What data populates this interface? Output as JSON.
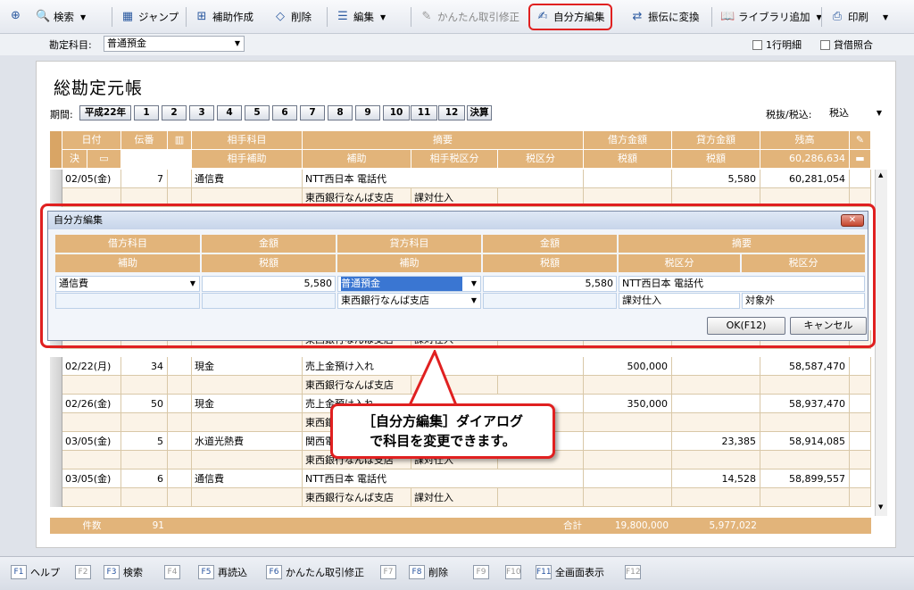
{
  "toolbar": {
    "search": "検索",
    "jump": "ジャンプ",
    "sub_create": "補助作成",
    "delete": "削除",
    "edit": "編集",
    "kantan": "かんたん取引修正",
    "jibun": "自分方編集",
    "furikae": "振伝に変換",
    "library": "ライブラリ追加",
    "print": "印刷"
  },
  "subbar": {
    "account_label": "勘定科目:",
    "account_value": "普通預金",
    "opt1": "1行明細",
    "opt2": "貸借照合"
  },
  "title": "総勘定元帳",
  "period": {
    "label": "期間:",
    "era": "平成22年",
    "months": [
      "1",
      "2",
      "3",
      "4",
      "5",
      "6",
      "7",
      "8",
      "9",
      "10",
      "11",
      "12"
    ],
    "settle": "決算"
  },
  "tax": {
    "label": "税抜/税込:",
    "value": "税込"
  },
  "grid_header": {
    "date": "日付",
    "denpyo": "伝番",
    "aite": "相手科目",
    "tekiyo": "摘要",
    "debit": "借方金額",
    "credit": "貸方金額",
    "balance": "残高",
    "ketsu": "決",
    "aite_sub": "相手補助",
    "sub": "補助",
    "aite_tax": "相手税区分",
    "taxcls": "税区分",
    "tax1": "税額",
    "tax2": "税額",
    "bal2": "60,286,634"
  },
  "rows": [
    {
      "date": "02/05(金)",
      "no": "7",
      "acct": "通信費",
      "desc": "NTT西日本 電話代",
      "debit": "",
      "credit": "5,580",
      "bal": "60,281,054",
      "bank": "東西銀行なんば支店",
      "tax": "課対仕入"
    },
    {
      "date": "",
      "no": "",
      "acct": "",
      "desc": "",
      "debit": "",
      "credit": "",
      "bal": "",
      "bank": "東西銀行なんば支店",
      "tax": "課対仕入"
    },
    {
      "date": "02/22(月)",
      "no": "34",
      "acct": "現金",
      "desc": "売上金預け入れ",
      "debit": "500,000",
      "credit": "",
      "bal": "58,587,470",
      "bank": "東西銀行なんば支店",
      "tax": ""
    },
    {
      "date": "02/26(金)",
      "no": "50",
      "acct": "現金",
      "desc": "売上金預け入れ",
      "debit": "350,000",
      "credit": "",
      "bal": "58,937,470",
      "bank": "東西銀行なんば支店",
      "tax": ""
    },
    {
      "date": "03/05(金)",
      "no": "5",
      "acct": "水道光熱費",
      "desc": "関西電力",
      "debit": "",
      "credit": "23,385",
      "bal": "58,914,085",
      "bank": "東西銀行なんば支店",
      "tax": "課対仕入"
    },
    {
      "date": "03/05(金)",
      "no": "6",
      "acct": "通信費",
      "desc": "NTT西日本 電話代",
      "debit": "",
      "credit": "14,528",
      "bal": "58,899,557",
      "bank": "東西銀行なんば支店",
      "tax": "課対仕入"
    }
  ],
  "footer": {
    "count_label": "件数",
    "count": "91",
    "total_label": "合計",
    "debit_total": "19,800,000",
    "credit_total": "5,977,022"
  },
  "dialog": {
    "title": "自分方編集",
    "h_debit": "借方科目",
    "h_amount": "金額",
    "h_credit": "貸方科目",
    "h_amount2": "金額",
    "h_tekiyo": "摘要",
    "h_sub": "補助",
    "h_tax": "税額",
    "h_sub2": "補助",
    "h_tax2": "税額",
    "h_taxcls": "税区分",
    "h_taxcls2": "税区分",
    "debit_acct": "通信費",
    "amount": "5,580",
    "credit_acct": "普通預金",
    "amount2": "5,580",
    "tekiyo": "NTT西日本 電話代",
    "bank": "東西銀行なんば支店",
    "taxcls1": "課対仕入",
    "taxcls2": "対象外",
    "ok": "OK(F12)",
    "cancel": "キャンセル"
  },
  "callout": {
    "line1": "［自分方編集］ダイアログ",
    "line2": "で科目を変更できます。"
  },
  "fkeys": [
    {
      "k": "F1",
      "l": "ヘルプ"
    },
    {
      "k": "F2",
      "l": ""
    },
    {
      "k": "F3",
      "l": "検索"
    },
    {
      "k": "F4",
      "l": ""
    },
    {
      "k": "F5",
      "l": "再読込"
    },
    {
      "k": "F6",
      "l": "かんたん取引修正"
    },
    {
      "k": "F7",
      "l": ""
    },
    {
      "k": "F8",
      "l": "削除"
    },
    {
      "k": "F9",
      "l": ""
    },
    {
      "k": "F10",
      "l": ""
    },
    {
      "k": "F11",
      "l": "全画面表示"
    },
    {
      "k": "F12",
      "l": ""
    }
  ]
}
